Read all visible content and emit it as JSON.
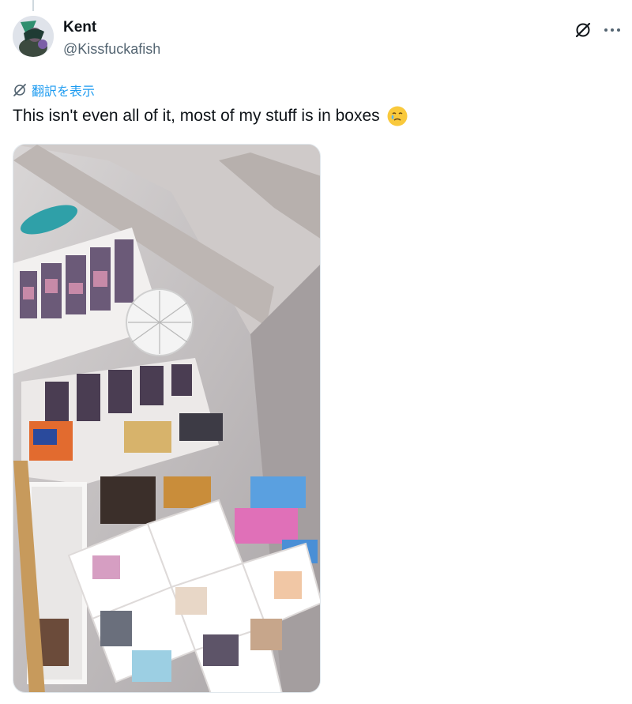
{
  "author": {
    "display_name": "Kent",
    "handle": "@Kissfuckafish"
  },
  "translate": {
    "label": "翻訳を表示"
  },
  "tweet": {
    "text": "This isn't even all of it, most of my stuff is in boxes",
    "emoji": "face-holding-back-tears"
  },
  "icons": {
    "grok": "grok-icon",
    "more": "more-dots-icon",
    "translate": "translate-icon"
  },
  "colors": {
    "link": "#1d9bf0",
    "secondary_text": "#536471",
    "primary_text": "#0f1419"
  }
}
